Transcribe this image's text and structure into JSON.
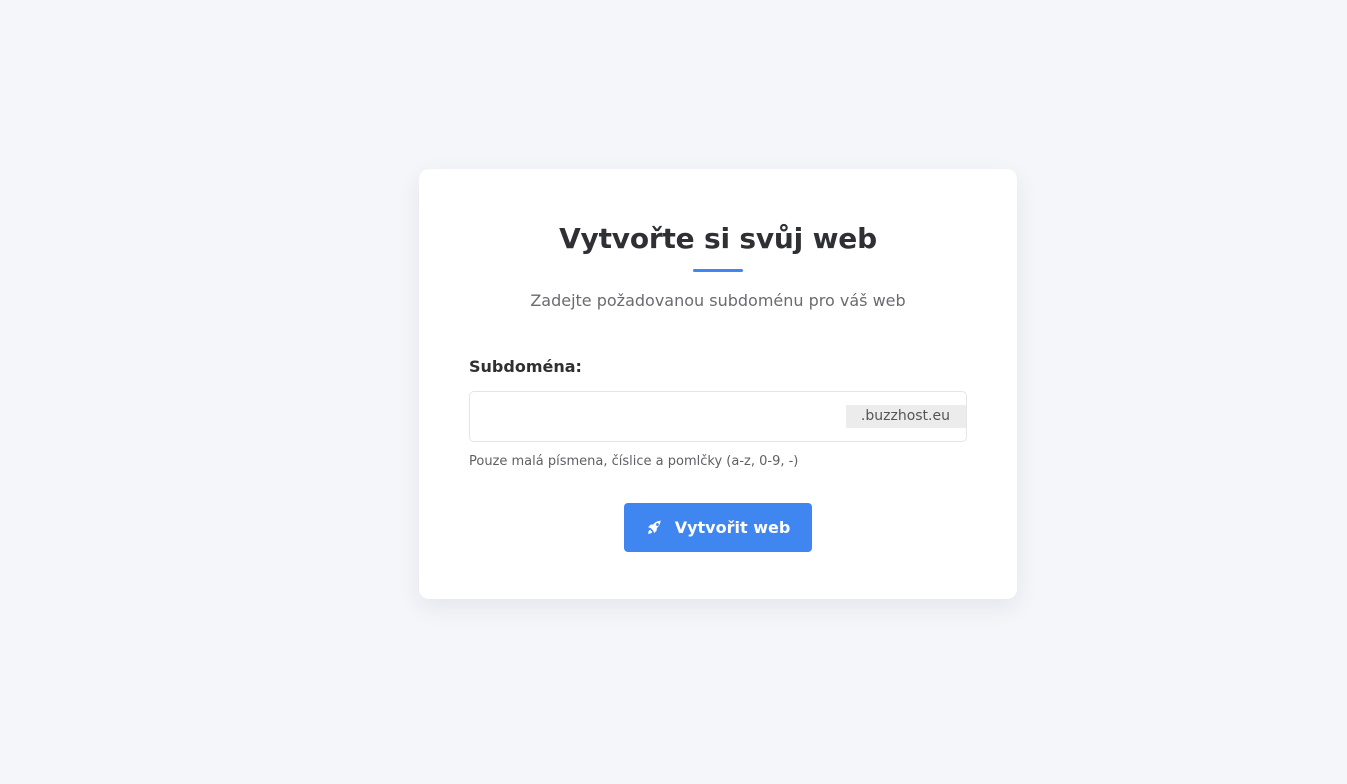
{
  "form": {
    "title": "Vytvořte si svůj web",
    "subtitle": "Zadejte požadovanou subdoménu pro váš web",
    "subdomain_label": "Subdoména:",
    "subdomain_value": "",
    "subdomain_placeholder": "",
    "domain_suffix": ".buzzhost.eu",
    "hint": "Pouze malá písmena, číslice a pomlčky (a-z, 0-9, -)",
    "submit_label": "Vytvořit web",
    "submit_icon": "rocket-icon"
  },
  "colors": {
    "accent": "#3f86f0",
    "background": "#f5f6fa",
    "card": "#ffffff"
  }
}
